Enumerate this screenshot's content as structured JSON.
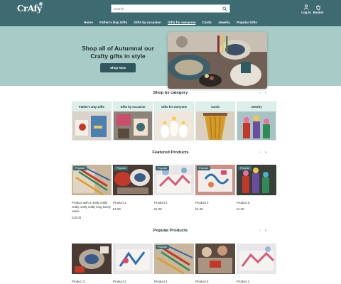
{
  "header": {
    "logo_text": "CrAfy",
    "search_placeholder": "Search",
    "login_label": "Log in",
    "basket_label": "Basket",
    "nav": [
      "Home",
      "Father's Day Gifts",
      "Gifts by occasion",
      "Gifts for everyone",
      "Cards",
      "Jewelry",
      "Popular Gifts"
    ],
    "active_nav": "Gifts for everyone",
    "bg_color": "#3e6a72"
  },
  "hero": {
    "title": "Shop all of Autumnal our Crafty gifts in style",
    "button_label": "Shop Now",
    "bg_color": "#a7cbc7"
  },
  "categories": {
    "title": "Shop by category",
    "items": [
      {
        "label": "Father's Day Gifts"
      },
      {
        "label": "Gifts by occasion"
      },
      {
        "label": "Gifts for everyone"
      },
      {
        "label": "Cards"
      },
      {
        "label": "Jewelry"
      }
    ]
  },
  "featured": {
    "title": "Featured Products",
    "items": [
      {
        "badge": "Popular",
        "name": "Product with a really really really really really long lonely name",
        "price": "£20.00"
      },
      {
        "badge": "Popular",
        "name": "Product 1",
        "price": "£1.00"
      },
      {
        "badge": "Popular",
        "name": "Product 2",
        "price": "£1.00"
      },
      {
        "badge": "Popular",
        "name": "Product 3",
        "price": "£1.00"
      },
      {
        "badge": "Popular",
        "name": "Product 6",
        "price": "£1.00"
      }
    ]
  },
  "popular": {
    "title": "Popular Products",
    "items": [
      {
        "badge": "",
        "name": "Product 3"
      },
      {
        "badge": "",
        "name": "Product 2"
      },
      {
        "badge": "Popular",
        "name": "Product 4"
      },
      {
        "badge": "",
        "name": "Product 5"
      },
      {
        "badge": "",
        "name": "Product 2"
      }
    ]
  },
  "arrows": {
    "prev": "‹",
    "next": "›"
  }
}
